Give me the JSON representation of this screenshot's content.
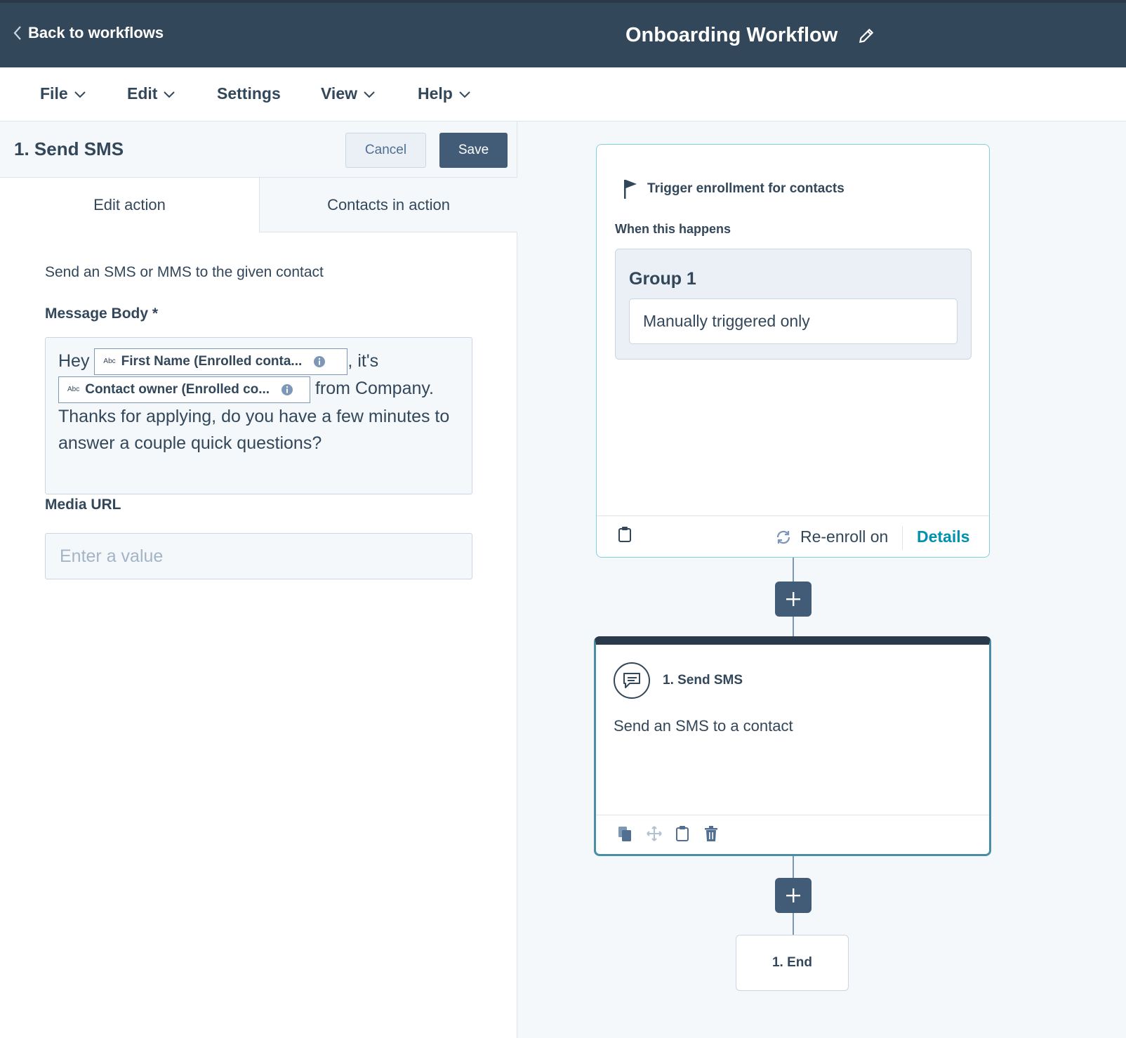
{
  "header": {
    "back_label": "Back to workflows",
    "workflow_title": "Onboarding Workflow"
  },
  "menu": {
    "items": [
      {
        "label": "File",
        "has_dropdown": true
      },
      {
        "label": "Edit",
        "has_dropdown": true
      },
      {
        "label": "Settings",
        "has_dropdown": false
      },
      {
        "label": "View",
        "has_dropdown": true
      },
      {
        "label": "Help",
        "has_dropdown": true
      }
    ]
  },
  "panel": {
    "title": "1. Send SMS",
    "cancel_label": "Cancel",
    "save_label": "Save",
    "tabs": [
      {
        "label": "Edit action",
        "active": true
      },
      {
        "label": "Contacts in action",
        "active": false
      }
    ],
    "description": "Send an SMS or MMS to the given contact",
    "message_body": {
      "label": "Message Body *",
      "text_hey": "Hey",
      "token_first_name": "First Name (Enrolled conta...",
      "text_its": ", it's",
      "token_owner": "Contact owner (Enrolled co...",
      "text_rest": "from Company. Thanks for applying, do you have a few minutes to answer a couple quick questions?",
      "token_type": "Abc"
    },
    "media_url": {
      "label": "Media URL",
      "placeholder": "Enter a value",
      "value": ""
    }
  },
  "canvas": {
    "trigger": {
      "title": "Trigger enrollment for contacts",
      "when_label": "When this happens",
      "group_title": "Group 1",
      "group_condition": "Manually triggered only",
      "reenroll_label": "Re-enroll on",
      "details_label": "Details"
    },
    "action": {
      "title": "1. Send SMS",
      "description": "Send an SMS to a contact"
    },
    "end": {
      "label": "1. End"
    }
  },
  "colors": {
    "header_bg": "#33475b",
    "primary_button": "#425b76",
    "link": "#0091ae",
    "trigger_border": "#7fd1de",
    "selected_border": "#4a8ea5"
  }
}
